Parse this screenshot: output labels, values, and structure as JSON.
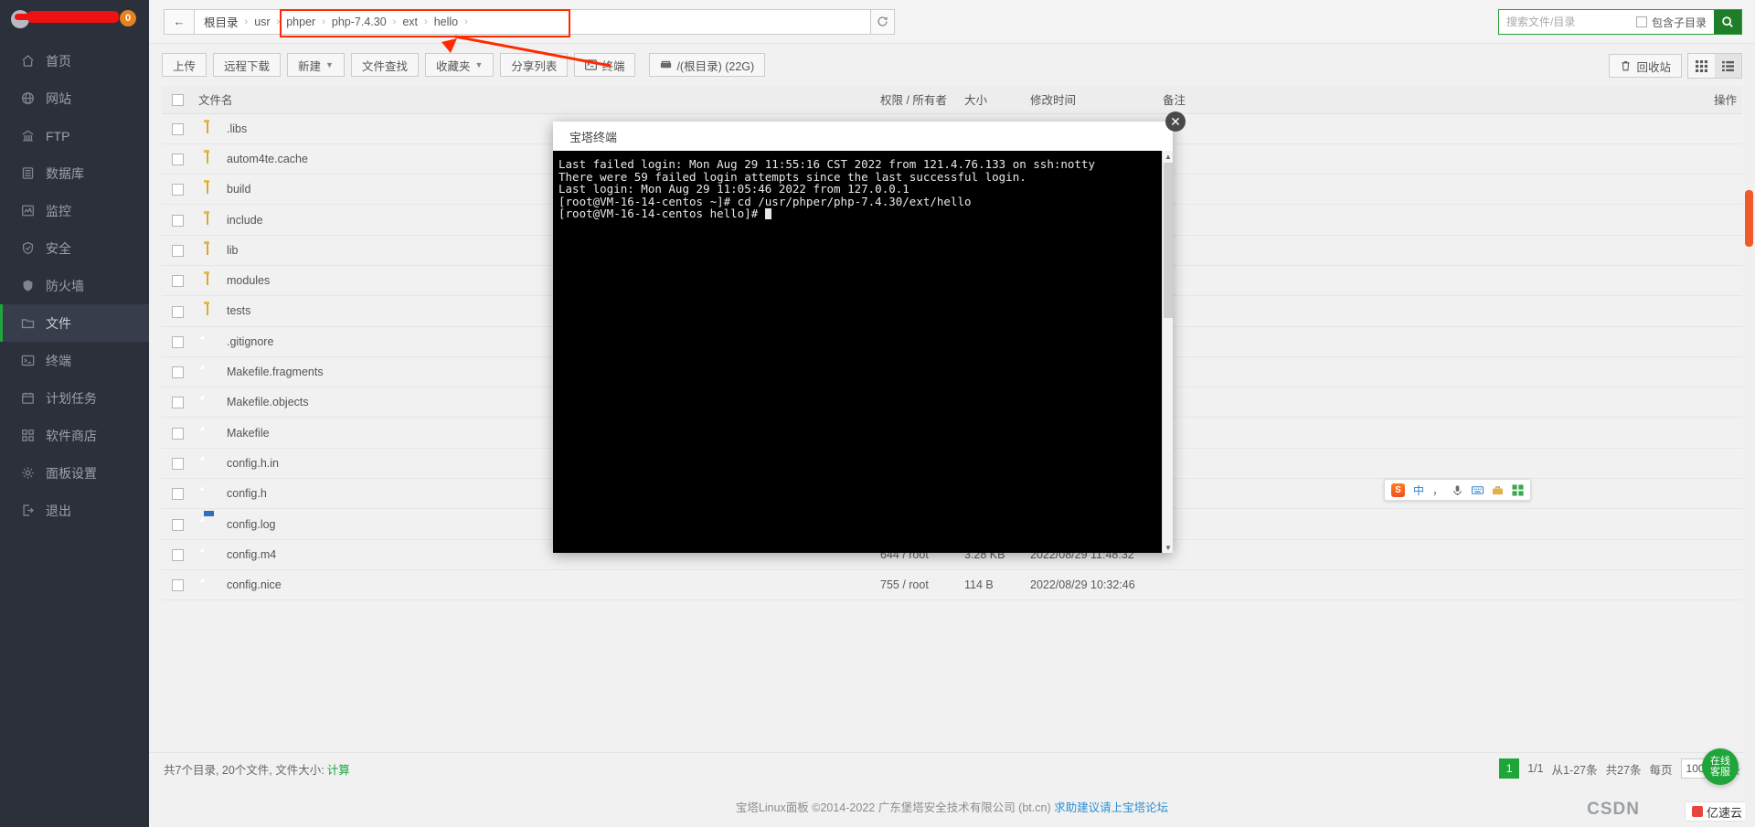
{
  "sidebar": {
    "badge": "0",
    "items": [
      {
        "label": "首页",
        "icon": "home-icon",
        "active": false
      },
      {
        "label": "网站",
        "icon": "globe-icon",
        "active": false
      },
      {
        "label": "FTP",
        "icon": "bank-icon",
        "active": false
      },
      {
        "label": "数据库",
        "icon": "database-icon",
        "active": false
      },
      {
        "label": "监控",
        "icon": "monitor-icon",
        "active": false
      },
      {
        "label": "安全",
        "icon": "shield-check-icon",
        "active": false
      },
      {
        "label": "防火墙",
        "icon": "shield-icon",
        "active": false
      },
      {
        "label": "文件",
        "icon": "folder-icon",
        "active": true
      },
      {
        "label": "终端",
        "icon": "terminal-icon",
        "active": false
      },
      {
        "label": "计划任务",
        "icon": "calendar-icon",
        "active": false
      },
      {
        "label": "软件商店",
        "icon": "grid-icon",
        "active": false
      },
      {
        "label": "面板设置",
        "icon": "gear-icon",
        "active": false
      },
      {
        "label": "退出",
        "icon": "logout-icon",
        "active": false
      }
    ]
  },
  "pathbar": {
    "back_label": "←",
    "crumbs": [
      "根目录",
      "usr",
      "phper",
      "php-7.4.30",
      "ext",
      "hello"
    ],
    "separator": "›",
    "reload_icon": "refresh-icon"
  },
  "search": {
    "placeholder": "搜索文件/目录",
    "value": "",
    "subdir_label": "包含子目录",
    "subdir_checked": false,
    "go_icon": "search-icon"
  },
  "toolbar": {
    "buttons": [
      {
        "label": "上传",
        "caret": false,
        "icon": ""
      },
      {
        "label": "远程下载",
        "caret": false,
        "icon": ""
      },
      {
        "label": "新建",
        "caret": true,
        "icon": ""
      },
      {
        "label": "文件查找",
        "caret": false,
        "icon": ""
      },
      {
        "label": "收藏夹",
        "caret": true,
        "icon": ""
      },
      {
        "label": "分享列表",
        "caret": false,
        "icon": ""
      },
      {
        "label": "终端",
        "caret": false,
        "icon": "terminal-icon"
      }
    ],
    "disk_label": "/(根目录) (22G)",
    "disk_icon": "disk-icon",
    "recycle_label": "回收站",
    "recycle_icon": "trash-icon",
    "view_grid_icon": "grid-view-icon",
    "view_list_icon": "list-view-icon",
    "active_view": "list"
  },
  "table": {
    "headers": [
      "文件名",
      "权限 / 所有者",
      "大小",
      "修改时间",
      "备注",
      "操作"
    ],
    "rows": [
      {
        "name": ".libs",
        "type": "folder",
        "perm": "",
        "size": "",
        "time": "",
        "note": ""
      },
      {
        "name": "autom4te.cache",
        "type": "folder",
        "perm": "",
        "size": "",
        "time": "",
        "note": ""
      },
      {
        "name": "build",
        "type": "folder",
        "perm": "",
        "size": "",
        "time": "",
        "note": ""
      },
      {
        "name": "include",
        "type": "folder",
        "perm": "",
        "size": "",
        "time": "",
        "note": ""
      },
      {
        "name": "lib",
        "type": "folder",
        "perm": "",
        "size": "",
        "time": "",
        "note": ""
      },
      {
        "name": "modules",
        "type": "folder",
        "perm": "",
        "size": "",
        "time": "",
        "note": ""
      },
      {
        "name": "tests",
        "type": "folder",
        "perm": "",
        "size": "",
        "time": "",
        "note": ""
      },
      {
        "name": ".gitignore",
        "type": "file",
        "perm": "",
        "size": "",
        "time": "",
        "note": ""
      },
      {
        "name": "Makefile.fragments",
        "type": "file",
        "perm": "",
        "size": "",
        "time": "",
        "note": ""
      },
      {
        "name": "Makefile.objects",
        "type": "file",
        "perm": "",
        "size": "",
        "time": "",
        "note": ""
      },
      {
        "name": "Makefile",
        "type": "file",
        "perm": "",
        "size": "",
        "time": "",
        "note": ""
      },
      {
        "name": "config.h.in",
        "type": "file",
        "perm": "",
        "size": "",
        "time": "",
        "note": ""
      },
      {
        "name": "config.h",
        "type": "file",
        "perm": "",
        "size": "",
        "time": "",
        "note": ""
      },
      {
        "name": "config.log",
        "type": "log",
        "perm": "",
        "size": "",
        "time": "",
        "note": ""
      },
      {
        "name": "config.m4",
        "type": "file",
        "perm": "644 / root",
        "size": "3.28 KB",
        "time": "2022/08/29 11:48:32",
        "note": ""
      },
      {
        "name": "config.nice",
        "type": "file",
        "perm": "755 / root",
        "size": "114 B",
        "time": "2022/08/29 10:32:46",
        "note": ""
      }
    ]
  },
  "status": {
    "summary": "共7个目录, 20个文件, 文件大小:",
    "calc_label": "计算"
  },
  "pager": {
    "current_page": "1",
    "page_of": "1/1",
    "range": "从1-27条",
    "total": "共27条",
    "per_page_prefix": "每页",
    "per_page_value": "100",
    "per_page_suffix": "条"
  },
  "footer": {
    "text": "宝塔Linux面板 ©2014-2022 广东堡塔安全技术有限公司 (bt.cn)",
    "link1": "求助建议请上宝塔论坛",
    "csdn": "CSDN",
    "yisu": "亿速云"
  },
  "online": {
    "line1": "在线",
    "line2": "客服"
  },
  "terminal": {
    "title": "宝塔终端",
    "close_icon": "close-icon",
    "lines": [
      "Last failed login: Mon Aug 29 11:55:16 CST 2022 from 121.4.76.133 on ssh:notty",
      "There were 59 failed login attempts since the last successful login.",
      "Last login: Mon Aug 29 11:05:46 2022 from 127.0.0.1",
      "[root@VM-16-14-centos ~]# cd /usr/phper/php-7.4.30/ext/hello",
      "[root@VM-16-14-centos hello]# "
    ]
  },
  "ime": {
    "logo": "S",
    "mode": "中",
    "keys": [
      "voice-icon",
      "keyboard-icon",
      "toolbox-icon",
      "apps-icon"
    ],
    "punct": "，"
  },
  "colors": {
    "accent": "#20a53a",
    "sidebar_bg": "#2b303b",
    "annotation_red": "#ff2a00",
    "badge_orange": "#e8821e"
  }
}
